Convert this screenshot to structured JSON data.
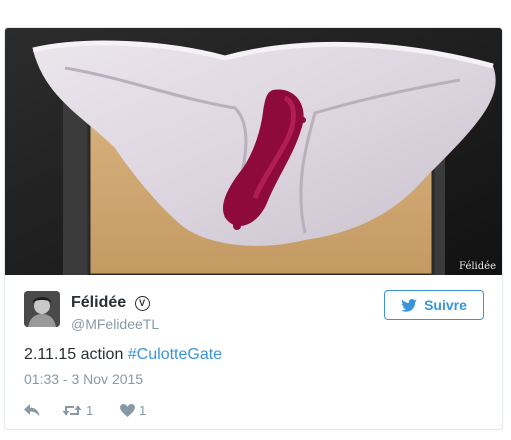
{
  "media": {
    "watermark": "Félidée"
  },
  "author": {
    "display_name": "Félidée",
    "verified_symbol": "V",
    "handle": "@MFelideeTL"
  },
  "follow_button": {
    "label": "Suivre",
    "icon": "bird-icon"
  },
  "tweet": {
    "text_plain": "2.11.15 action ",
    "hashtag": "#CulotteGate",
    "timestamp": "01:33 - 3 Nov 2015"
  },
  "actions": {
    "reply_icon": "reply-icon",
    "retweet_icon": "retweet-icon",
    "retweet_count": "1",
    "like_icon": "heart-icon",
    "like_count": "1"
  },
  "colors": {
    "accent": "#3b94d9",
    "text": "#292f33",
    "muted": "#8899a6",
    "border": "#e1e8ed"
  }
}
